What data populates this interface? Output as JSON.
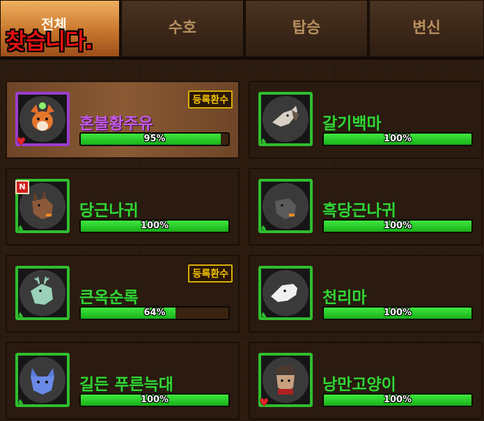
{
  "tabs": [
    {
      "label": "전체",
      "active": true
    },
    {
      "label": "수호",
      "active": false
    },
    {
      "label": "탑승",
      "active": false
    },
    {
      "label": "변신",
      "active": false
    }
  ],
  "overlay_text": "찾습니다.",
  "register_tag": "등록환수",
  "pets": [
    {
      "name": "혼불황주유",
      "hp": "95%",
      "hp_value": 0.95,
      "frame": "purple",
      "tag": "등록환수",
      "badge": "heart"
    },
    {
      "name": "갈기백마",
      "hp": "100%",
      "hp_value": 1.0,
      "frame": "green",
      "tag": "",
      "badge": "horse"
    },
    {
      "name": "당근나귀",
      "hp": "100%",
      "hp_value": 1.0,
      "frame": "green",
      "tag": "",
      "badge": "horse",
      "new": "N"
    },
    {
      "name": "흑당근나귀",
      "hp": "100%",
      "hp_value": 1.0,
      "frame": "green",
      "tag": "",
      "badge": "horse"
    },
    {
      "name": "큰옥순록",
      "hp": "64%",
      "hp_value": 0.64,
      "frame": "green",
      "tag": "등록환수",
      "badge": "horse"
    },
    {
      "name": "천리마",
      "hp": "100%",
      "hp_value": 1.0,
      "frame": "green",
      "tag": "",
      "badge": "horse"
    },
    {
      "name": "길든 푸른늑대",
      "hp": "100%",
      "hp_value": 1.0,
      "frame": "green",
      "tag": "",
      "badge": "horse"
    },
    {
      "name": "낭만고양이",
      "hp": "100%",
      "hp_value": 1.0,
      "frame": "green",
      "tag": "",
      "badge": "heart"
    }
  ],
  "colors": {
    "accent_green": "#2fbe2f",
    "purple": "#9a3dd0",
    "tag_yellow": "#f2c400"
  }
}
